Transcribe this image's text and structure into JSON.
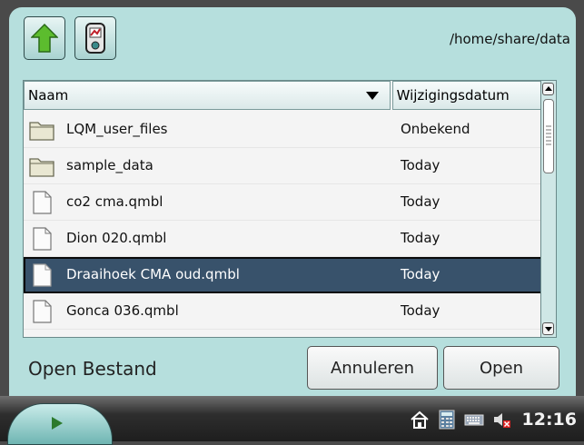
{
  "window": {
    "path": "/home/share/data"
  },
  "toolbar": {
    "up_icon": "up-arrow-icon",
    "device_icon": "device-icon"
  },
  "list": {
    "columns": [
      "Naam",
      "Wijzigingsdatum"
    ],
    "sort_icon": "sort-desc-icon",
    "rows": [
      {
        "name": "LQM_user_files",
        "date": "Onbekend",
        "icon": "folder-icon",
        "selected": false
      },
      {
        "name": "sample_data",
        "date": "Today",
        "icon": "folder-icon",
        "selected": false
      },
      {
        "name": "co2 cma.qmbl",
        "date": "Today",
        "icon": "file-icon",
        "selected": false
      },
      {
        "name": "Dion 020.qmbl",
        "date": "Today",
        "icon": "file-icon",
        "selected": false
      },
      {
        "name": "Draaihoek CMA oud.qmbl",
        "date": "Today",
        "icon": "file-icon",
        "selected": true
      },
      {
        "name": "Gonca 036.qmbl",
        "date": "Today",
        "icon": "file-icon",
        "selected": false
      }
    ]
  },
  "footer": {
    "title": "Open Bestand",
    "cancel_label": "Annuleren",
    "open_label": "Open"
  },
  "taskbar": {
    "clock": "12:16",
    "tray_icons": [
      "home-icon",
      "calculator-icon",
      "keyboard-icon",
      "volume-muted-icon"
    ]
  },
  "colors": {
    "window_bg": "#b6dfdd",
    "selection": "#38526b",
    "taskbar": "#2e2e2e"
  }
}
